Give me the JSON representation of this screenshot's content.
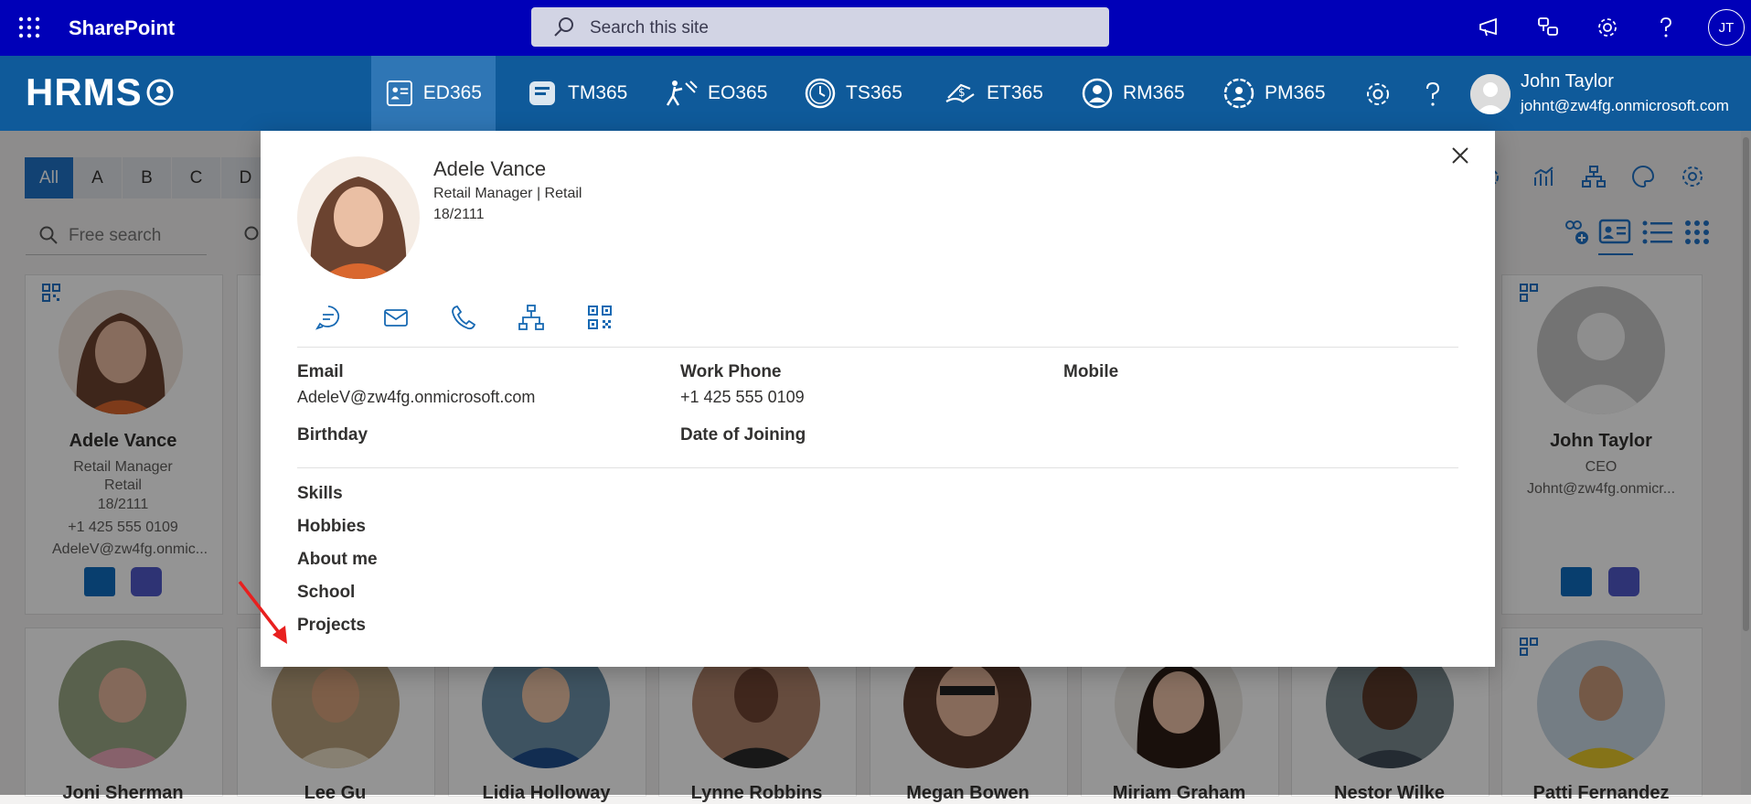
{
  "suitebar": {
    "app_name": "SharePoint",
    "search_placeholder": "Search this site",
    "user_initials": "JT"
  },
  "hrms": {
    "logo": "HRMS",
    "tabs": [
      {
        "label": "ED365",
        "active": true
      },
      {
        "label": "TM365",
        "active": false
      },
      {
        "label": "EO365",
        "active": false
      },
      {
        "label": "TS365",
        "active": false
      },
      {
        "label": "ET365",
        "active": false
      },
      {
        "label": "RM365",
        "active": false
      },
      {
        "label": "PM365",
        "active": false
      }
    ],
    "user": {
      "name": "John Taylor",
      "email": "johnt@zw4fg.onmicrosoft.com"
    }
  },
  "directory": {
    "alphabet": [
      "All",
      "A",
      "B",
      "C",
      "D"
    ],
    "free_search_placeholder": "Free search",
    "cards_top": [
      {
        "name": "Adele Vance",
        "title": "Retail Manager",
        "dept": "Retail",
        "id": "18/2111",
        "phone": "+1 425 555 0109",
        "email": "AdeleV@zw4fg.onmic..."
      },
      {
        "name": "John Taylor",
        "title": "CEO",
        "email": "Johnt@zw4fg.onmicr..."
      }
    ],
    "cards_bottom": [
      {
        "name": "Joni Sherman"
      },
      {
        "name": "Lee Gu"
      },
      {
        "name": "Lidia Holloway"
      },
      {
        "name": "Lynne Robbins"
      },
      {
        "name": "Megan Bowen"
      },
      {
        "name": "Miriam Graham"
      },
      {
        "name": "Nestor Wilke"
      },
      {
        "name": "Patti Fernandez"
      }
    ]
  },
  "modal": {
    "name": "Adele Vance",
    "title_line": "Retail Manager | Retail",
    "id": "18/2111",
    "fields": {
      "email_label": "Email",
      "email_value": "AdeleV@zw4fg.onmicrosoft.com",
      "work_phone_label": "Work Phone",
      "work_phone_value": "+1 425 555 0109",
      "mobile_label": "Mobile",
      "birthday_label": "Birthday",
      "doj_label": "Date of Joining"
    },
    "sections": [
      "Skills",
      "Hobbies",
      "About me",
      "School",
      "Projects"
    ]
  },
  "colors": {
    "suitebar": "#0000b8",
    "hrmsbar": "#0f5a9a",
    "accent": "#2073c7",
    "annotation": "#e8201f"
  }
}
